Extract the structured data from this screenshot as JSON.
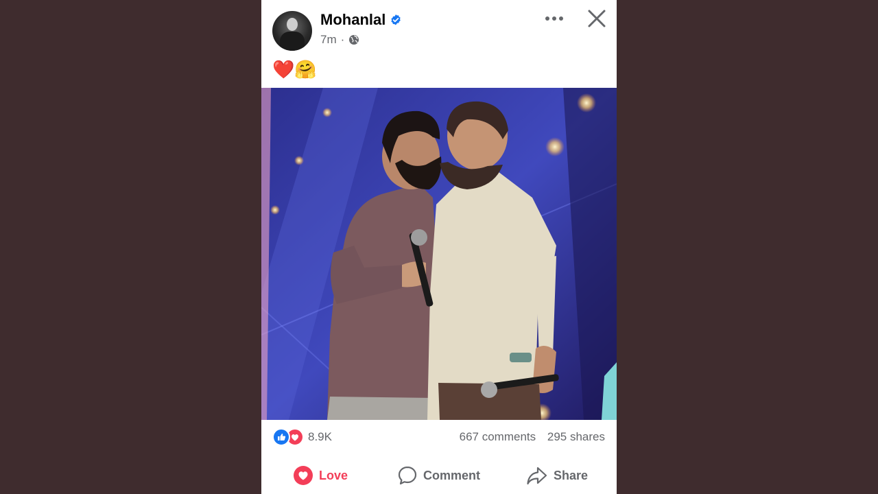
{
  "post": {
    "author": "Mohanlal",
    "time": "7m",
    "separator": "·",
    "caption": "❤️🤗",
    "stats": {
      "reaction_count": "8.9K",
      "comments": "667 comments",
      "shares": "295 shares"
    },
    "actions": {
      "love": "Love",
      "comment": "Comment",
      "share": "Share"
    }
  },
  "icons": {
    "verified": "verified-badge-icon",
    "audience": "globe-icon",
    "more": "more-dots-icon",
    "close": "close-icon",
    "like": "like-icon",
    "love": "love-icon",
    "comment": "comment-icon",
    "share": "share-icon"
  },
  "colors": {
    "brand_blue": "#1877f2",
    "love_red": "#f33e58",
    "secondary_text": "#65676b",
    "backdrop": "#3f2c2e"
  }
}
